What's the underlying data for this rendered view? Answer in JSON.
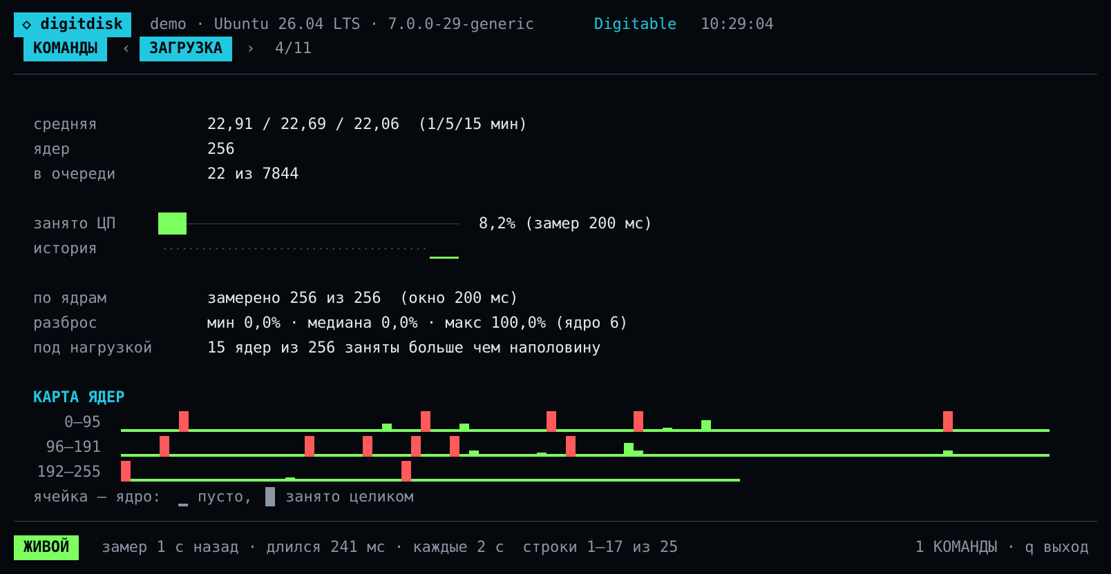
{
  "header": {
    "app_badge": "◇ digitdisk",
    "host_info": "demo · Ubuntu 26.04 LTS · 7.0.0-29-generic",
    "theme": "Digitable",
    "clock": "10:29:04"
  },
  "nav": {
    "left_tab": "КОМАНДЫ",
    "prev": "‹",
    "current_tab": "ЗАГРУЗКА",
    "next": "›",
    "page": "4/11"
  },
  "stats": {
    "avg_label": "средняя",
    "avg_value": "22,91 / 22,69 / 22,06  (1/5/15 мин)",
    "cores_label": "ядер",
    "cores_value": "256",
    "queue_label": "в очереди",
    "queue_value": "22 из 7844"
  },
  "cpu": {
    "busy_label": "занято ЦП",
    "busy_value": "8,2% (замер 200 мс)",
    "busy_fraction": 0.082,
    "history_label": "история"
  },
  "percore": {
    "label": "по ядрам",
    "value": "замерено 256 из 256  (окно 200 мс)",
    "spread_label": "разброс",
    "spread_value": "мин 0,0% · медиана 0,0% · макс 100,0% (ядро 6)",
    "loaded_label": "под нагрузкой",
    "loaded_value": "15 ядер из 256 заняты больше чем наполовину"
  },
  "coremap": {
    "title": "КАРТА ЯДЕР",
    "rows": [
      {
        "label": "0–95",
        "cores": 96
      },
      {
        "label": "96–191",
        "cores": 96
      },
      {
        "label": "192–255",
        "cores": 64
      }
    ],
    "high": [
      6,
      31,
      44,
      53,
      85,
      100,
      115,
      121,
      126,
      130,
      142,
      192,
      221
    ],
    "low": [
      {
        "core": 27,
        "level": 0.4
      },
      {
        "core": 35,
        "level": 0.4
      },
      {
        "core": 56,
        "level": 0.2
      },
      {
        "core": 60,
        "level": 0.55
      },
      {
        "core": 132,
        "level": 0.3
      },
      {
        "core": 139,
        "level": 0.15
      },
      {
        "core": 148,
        "level": 0.65
      },
      {
        "core": 149,
        "level": 0.3
      },
      {
        "core": 181,
        "level": 0.3
      },
      {
        "core": 209,
        "level": 0.2
      }
    ],
    "legend_prefix": "ячейка — ядро:",
    "legend_empty": "пусто,",
    "legend_full": "занято целиком"
  },
  "footer": {
    "live_badge": "ЖИВОЙ",
    "status": "замер 1 с назад · длился 241 мс · каждые 2 с  строки 1–17 из 25",
    "right": "1 КОМАНДЫ · q выход"
  },
  "colors": {
    "accent_cyan": "#22c8e0",
    "green": "#7cff5e",
    "red": "#ff5a5a"
  }
}
